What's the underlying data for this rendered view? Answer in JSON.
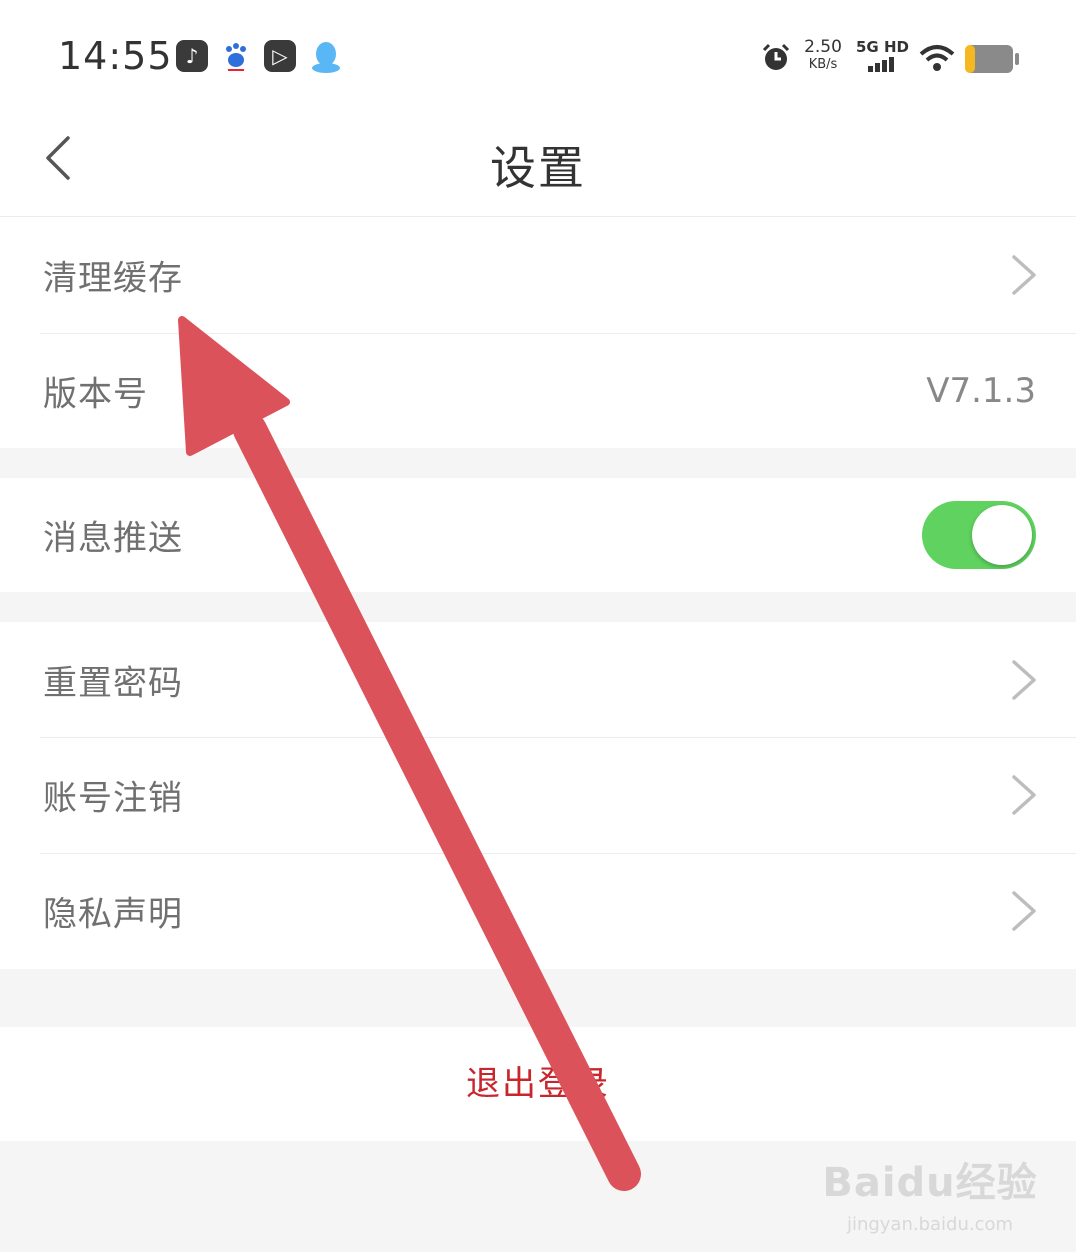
{
  "status_bar": {
    "time": "14:55",
    "app_icons": [
      "music-app-icon",
      "baidu-icon",
      "video-app-icon",
      "qq-icon"
    ],
    "speed_value": "2.50",
    "speed_unit": "KB/s",
    "network": "5G HD"
  },
  "header": {
    "title": "设置",
    "back_icon": "chevron-left-icon"
  },
  "groups": {
    "g1": [
      {
        "label": "清理缓存",
        "type": "chevron"
      },
      {
        "label": "版本号",
        "type": "value",
        "value": "V7.1.3"
      }
    ],
    "g2": [
      {
        "label": "消息推送",
        "type": "toggle",
        "on": true
      }
    ],
    "g3": [
      {
        "label": "重置密码",
        "type": "chevron"
      },
      {
        "label": "账号注销",
        "type": "chevron"
      },
      {
        "label": "隐私声明",
        "type": "chevron"
      }
    ]
  },
  "logout_label": "退出登录",
  "watermark": {
    "logo": "Baidu经验",
    "url": "jingyan.baidu.com"
  },
  "colors": {
    "accent_red": "#c8262c",
    "toggle_on": "#5fd25f",
    "annotation_arrow": "#dc525a"
  }
}
